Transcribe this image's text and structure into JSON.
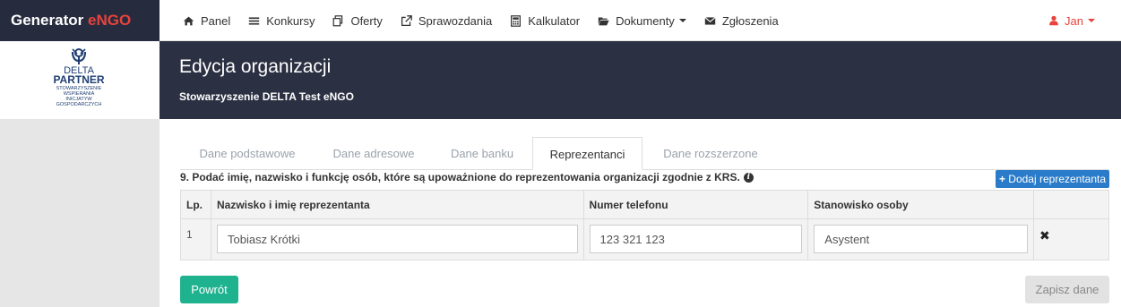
{
  "brand": {
    "name": "Generator",
    "accent": "eNGO"
  },
  "nav": {
    "items": [
      {
        "label": "Panel",
        "icon": "home-icon"
      },
      {
        "label": "Konkursy",
        "icon": "list-icon"
      },
      {
        "label": "Oferty",
        "icon": "copy-icon"
      },
      {
        "label": "Sprawozdania",
        "icon": "external-link-icon"
      },
      {
        "label": "Kalkulator",
        "icon": "calculator-icon"
      },
      {
        "label": "Dokumenty",
        "icon": "folder-open-icon"
      },
      {
        "label": "Zgłoszenia",
        "icon": "envelope-icon"
      }
    ],
    "user": "Jan"
  },
  "logo": {
    "line1": "DELTA",
    "line2": "PARTNER",
    "sub1": "STOWARZYSZENIE",
    "sub2": "WSPIERANIA",
    "sub3": "INICJATYW",
    "sub4": "GOSPODARCZYCH"
  },
  "header": {
    "title": "Edycja organizacji",
    "org": "Stowarzyszenie DELTA Test eNGO"
  },
  "tabs": [
    "Dane podstawowe",
    "Dane adresowe",
    "Dane banku",
    "Reprezentanci",
    "Dane rozszerzone"
  ],
  "question": "9. Podać imię, nazwisko i funkcję osób, które są upoważnione do reprezentowania organizacji zgodnie z KRS.",
  "add_button": "Dodaj reprezentanta",
  "table": {
    "headers": [
      "Lp.",
      "Nazwisko i imię reprezentanta",
      "Numer telefonu",
      "Stanowisko osoby"
    ],
    "rows": [
      {
        "lp": "1",
        "name": "Tobiasz Krótki",
        "phone": "123 321 123",
        "position": "Asystent"
      }
    ]
  },
  "buttons": {
    "back": "Powrót",
    "save": "Zapisz dane"
  },
  "colors": {
    "navy": "#262c3e",
    "accent_red": "#e8423b",
    "primary_blue": "#2a7bc9",
    "success_green": "#1fb28e"
  }
}
